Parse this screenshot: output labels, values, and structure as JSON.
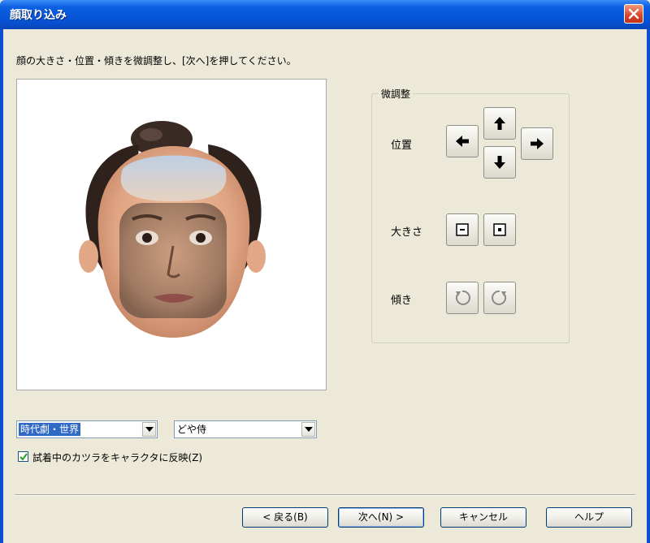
{
  "window": {
    "title": "顔取り込み",
    "instruction": "顔の大きさ・位置・傾きを微調整し、[次へ]を押してください。"
  },
  "adjust": {
    "legend": "微調整",
    "position_label": "位置",
    "size_label": "大きさ",
    "tilt_label": "傾き"
  },
  "dropdowns": {
    "category": {
      "value": "時代劇・世界"
    },
    "character": {
      "value": "どや侍"
    }
  },
  "checkbox": {
    "label": "試着中のカツラをキャラクタに反映(Z)",
    "checked": true
  },
  "buttons": {
    "back": "< 戻る(B)",
    "next": "次へ(N) >",
    "cancel": "キャンセル",
    "help": "ヘルプ"
  },
  "colors": {
    "titlebar": "#0652d6",
    "dialog_bg": "#ece9d8",
    "selection": "#316ac5",
    "close": "#d9442a"
  },
  "icons": [
    "close-icon",
    "arrow-left-icon",
    "arrow-up-icon",
    "arrow-down-icon",
    "arrow-right-icon",
    "shrink-icon",
    "enlarge-icon",
    "rotate-left-icon",
    "rotate-right-icon",
    "chevron-down-icon",
    "checkmark-icon"
  ]
}
